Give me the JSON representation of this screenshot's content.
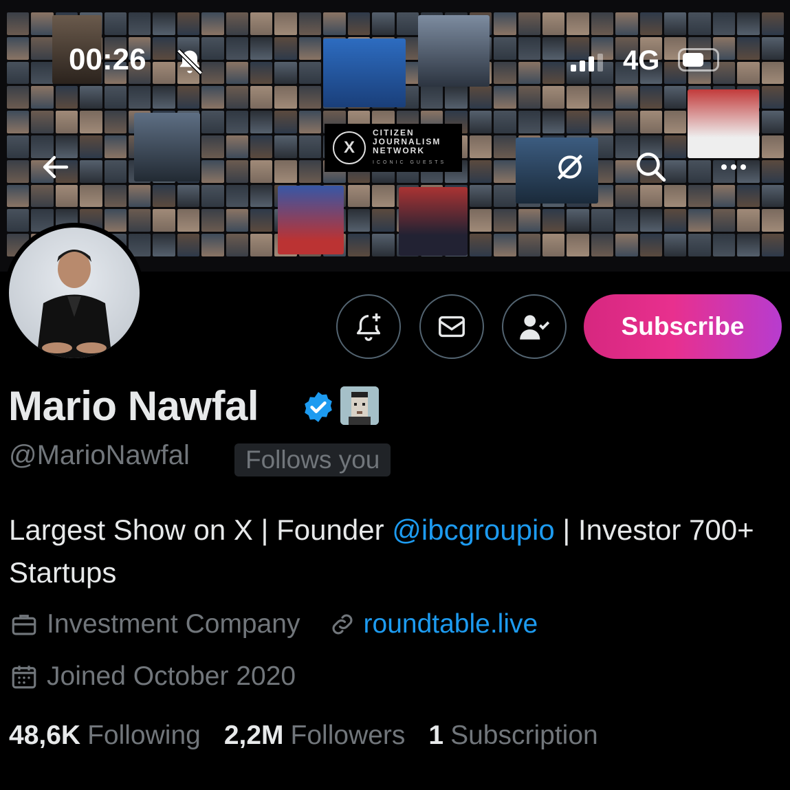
{
  "status_bar": {
    "time": "00:26",
    "network": "4G"
  },
  "banner": {
    "title_line1": "CITIZEN",
    "title_line2": "JOURNALISM",
    "title_line3": "NETWORK",
    "subtitle": "ICONIC GUESTS",
    "logo_letter": "X"
  },
  "actions": {
    "subscribe_label": "Subscribe"
  },
  "profile": {
    "name": "Mario Nawfal",
    "handle": "@MarioNawfal",
    "follows_you": "Follows you",
    "bio_part1": "Largest Show on X | Founder ",
    "bio_mention": "@ibcgroupio",
    "bio_part2": " | Investor 700+ Startups",
    "category": "Investment Company",
    "website": "roundtable.live",
    "joined": "Joined October 2020"
  },
  "stats": {
    "following_count": "48,6K",
    "following_label": "Following",
    "followers_count": "2,2M",
    "followers_label": "Followers",
    "subscription_count": "1",
    "subscription_label": "Subscription"
  },
  "colors": {
    "accent": "#1d9bf0",
    "subscribe_gradient_start": "#d6277f",
    "subscribe_gradient_end": "#b73ccf",
    "muted_text": "#71767b"
  }
}
